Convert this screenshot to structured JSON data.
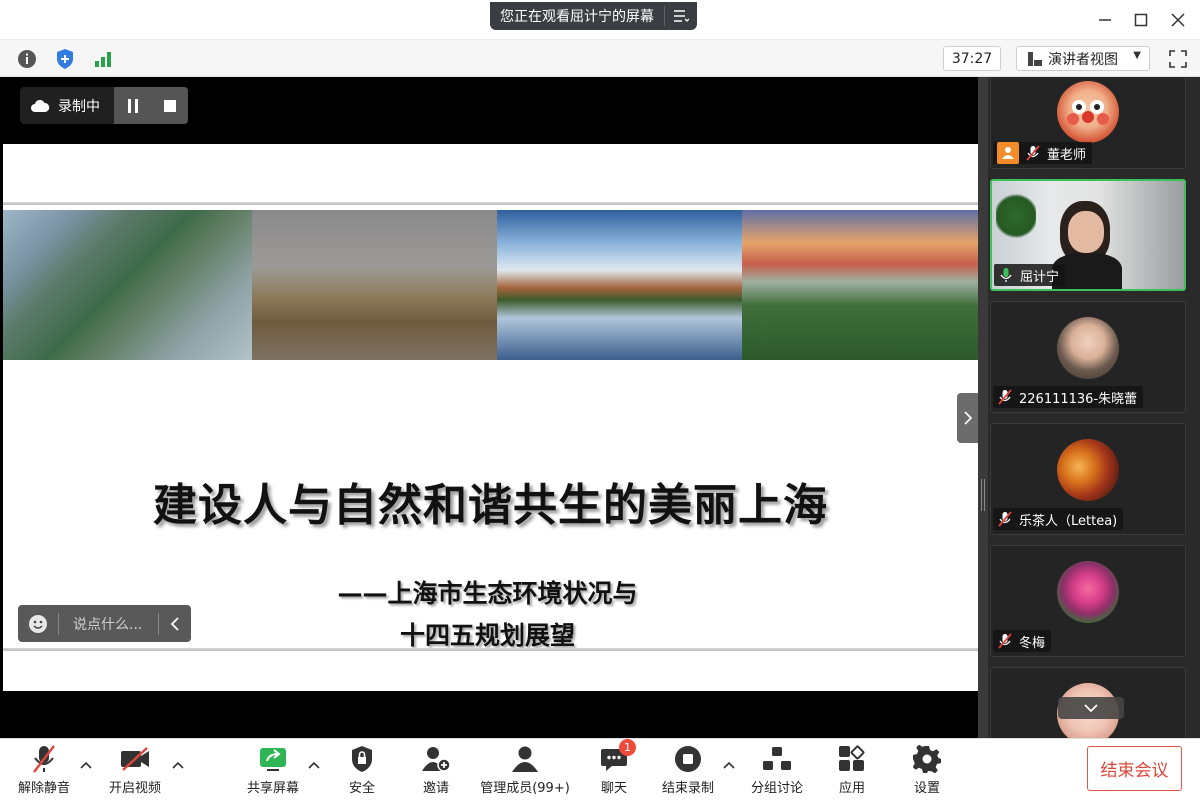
{
  "titlebar": {
    "share_banner": "您正在观看屈计宁的屏幕",
    "menu_icon": "list-menu-icon",
    "window_controls": [
      "minimize-icon",
      "maximize-icon",
      "close-icon"
    ]
  },
  "infobar": {
    "icons": [
      "info-icon",
      "shield-icon",
      "signal-bars-icon"
    ],
    "timer": "37:27",
    "view_mode": "演讲者视图",
    "fullscreen_icon": "fullscreen-icon"
  },
  "recording": {
    "label": "录制中",
    "pause_icon": "pause-icon",
    "stop_icon": "stop-icon"
  },
  "slide": {
    "title": "建设人与自然和谐共生的美丽上海",
    "subtitle_line1": "——上海市生态环境状况与",
    "subtitle_line2": "十四五规划展望"
  },
  "chat_input": {
    "placeholder": "说点什么..."
  },
  "participants": [
    {
      "name": "董老师",
      "muted": true,
      "host": true
    },
    {
      "name": "屈计宁",
      "muted": false,
      "active": true
    },
    {
      "name": "226111136-朱晓蕾",
      "muted": true
    },
    {
      "name": "乐茶人（Lettea)",
      "muted": true
    },
    {
      "name": "冬梅",
      "muted": true
    },
    {
      "name": "",
      "muted": true
    }
  ],
  "toolbar": {
    "unmute": "解除静音",
    "start_video": "开启视频",
    "share_screen": "共享屏幕",
    "security": "安全",
    "invite": "邀请",
    "manage_members": "管理成员(99+)",
    "chat": "聊天",
    "chat_badge": "1",
    "stop_recording": "结束录制",
    "breakout": "分组讨论",
    "apps": "应用",
    "settings": "设置",
    "end_meeting": "结束会议"
  },
  "colors": {
    "accent_green": "#3cc05a",
    "end_red": "#e0443a",
    "badge_red": "#f04a3c",
    "host_orange": "#f28c2a"
  }
}
